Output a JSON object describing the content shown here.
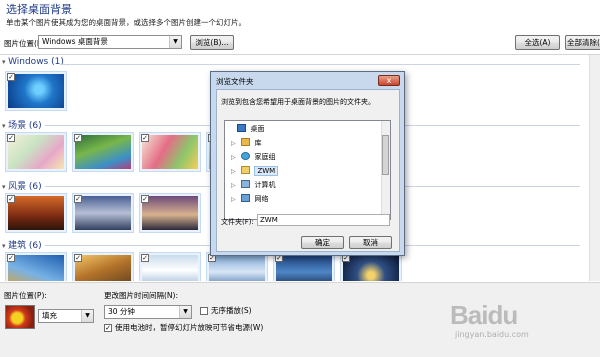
{
  "header": {
    "title": "选择桌面背景",
    "subtitle": "单击某个图片使其成为您的桌面背景，或选择多个图片创建一个幻灯片。"
  },
  "location": {
    "label": "图片位置(L):",
    "value": "Windows 桌面背景",
    "browse_label": "浏览(B)...",
    "select_all_label": "全选(A)",
    "clear_all_label": "全部清除(C)"
  },
  "gallery": {
    "groups": [
      {
        "label": "Windows (1)"
      },
      {
        "label": "场景 (6)"
      },
      {
        "label": "风景 (6)"
      },
      {
        "label": "建筑 (6)"
      }
    ]
  },
  "dialog": {
    "title": "浏览文件夹",
    "close_label": "x",
    "instruction": "浏览到包含您希望用于桌面背景的图片的文件夹。",
    "tree": [
      {
        "label": "桌面",
        "icon": "desktop-icon"
      },
      {
        "label": "库",
        "icon": "library-icon"
      },
      {
        "label": "家庭组",
        "icon": "homegroup-icon"
      },
      {
        "label": "ZWM",
        "icon": "user-folder-icon"
      },
      {
        "label": "计算机",
        "icon": "computer-icon"
      },
      {
        "label": "网络",
        "icon": "network-icon"
      }
    ],
    "folder_label": "文件夹(F):",
    "folder_value": "ZWM",
    "ok_label": "确定",
    "cancel_label": "取消"
  },
  "bottom": {
    "position_label": "图片位置(P):",
    "position_value": "填充",
    "interval_label": "更改图片时间间隔(N):",
    "interval_value": "30 分钟",
    "shuffle_label": "无序播放(S)",
    "battery_label": "使用电池时，暂停幻灯片放映可节省电源(W)"
  },
  "watermark": {
    "text": "Baidu",
    "sub": "jingyan.baidu.com"
  },
  "colors": {
    "group_title": "#1e3a8a",
    "dialog_frame": "#c8d9ee",
    "close_button": "#c9462c"
  }
}
